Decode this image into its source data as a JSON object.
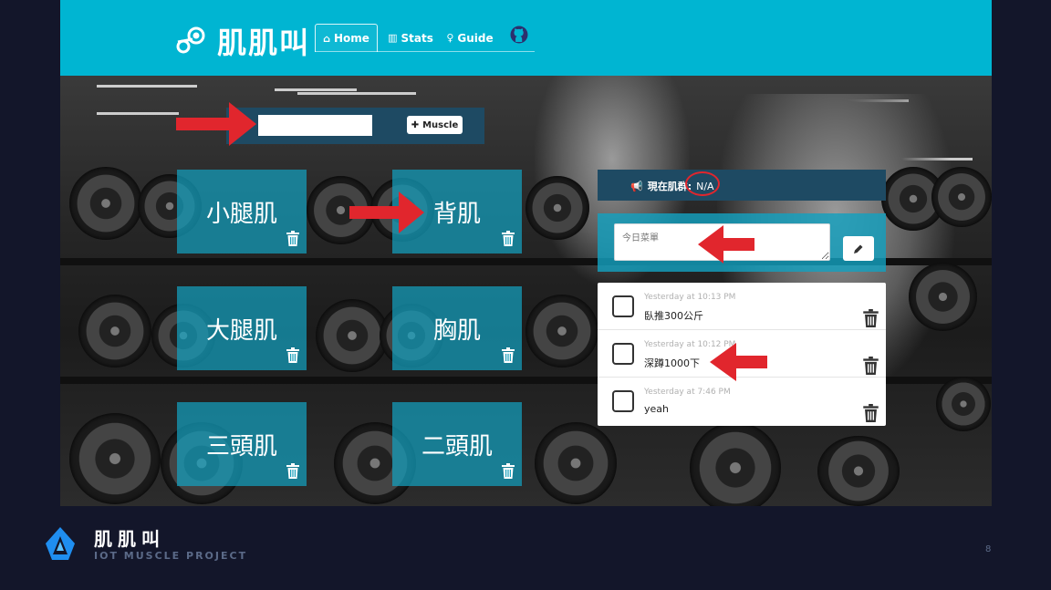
{
  "header": {
    "brand_title": "肌肌叫",
    "tabs": [
      {
        "label": "Home",
        "icon": "home-icon",
        "active": true
      },
      {
        "label": "Stats",
        "icon": "bar-chart-icon",
        "active": false
      },
      {
        "label": "Guide",
        "icon": "lightbulb-icon",
        "active": false
      }
    ],
    "github_icon": "github-icon"
  },
  "add_muscle": {
    "input_value": "",
    "button_label": "Muscle"
  },
  "muscles": [
    {
      "label": "小腿肌"
    },
    {
      "label": "背肌"
    },
    {
      "label": "大腿肌"
    },
    {
      "label": "胸肌"
    },
    {
      "label": "三頭肌"
    },
    {
      "label": "二頭肌"
    }
  ],
  "status": {
    "label": "現在肌群:",
    "value": "N/A"
  },
  "menu": {
    "textarea_placeholder": "今日菜單"
  },
  "todos": [
    {
      "time": "Yesterday at 10:13 PM",
      "text": "臥推300公斤",
      "checked": false
    },
    {
      "time": "Yesterday at 10:12 PM",
      "text": "深蹲1000下",
      "checked": false
    },
    {
      "time": "Yesterday at 7:46 PM",
      "text": "yeah",
      "checked": false
    }
  ],
  "footer": {
    "title": "肌肌叫",
    "subtitle": "IOT MUSCLE PROJECT",
    "page_number": "8"
  },
  "colors": {
    "navbar": "#00b5d2",
    "card": "#14a0be",
    "dark_bar": "#1e4a63",
    "annotation": "#e1262d",
    "slide_bg": "#13162a"
  }
}
